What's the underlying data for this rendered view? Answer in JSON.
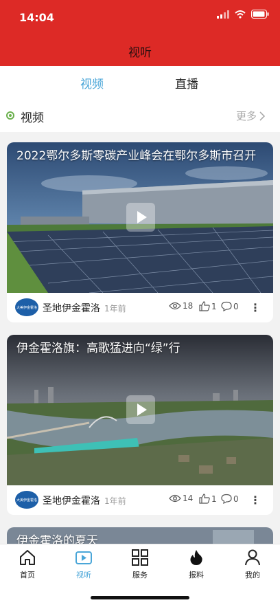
{
  "status_bar": {
    "time": "14:04"
  },
  "header": {
    "title": "视听"
  },
  "tabs": [
    {
      "label": "视频",
      "active": true
    },
    {
      "label": "直播",
      "active": false
    }
  ],
  "section": {
    "title": "视频",
    "more_label": "更多"
  },
  "videos": [
    {
      "title": "2022鄂尔多斯零碳产业峰会在鄂尔多斯市召开",
      "author": "圣地伊金霍洛",
      "time_ago": "1年前",
      "views": "18",
      "likes": "1",
      "comments": "0"
    },
    {
      "title": "伊金霍洛旗：高歌猛进向“绿”行",
      "author": "圣地伊金霍洛",
      "time_ago": "1年前",
      "views": "14",
      "likes": "1",
      "comments": "0"
    },
    {
      "title": "伊金霍洛的夏天"
    }
  ],
  "avatar_text": "大美伊金霍洛",
  "bottom_nav": [
    {
      "label": "首页",
      "icon": "home-icon",
      "active": false
    },
    {
      "label": "视听",
      "icon": "video-play-icon",
      "active": true
    },
    {
      "label": "服务",
      "icon": "grid-icon",
      "active": false
    },
    {
      "label": "报料",
      "icon": "flame-icon",
      "active": false
    },
    {
      "label": "我的",
      "icon": "user-icon",
      "active": false
    }
  ],
  "colors": {
    "brand_red": "#dd2a26",
    "accent_blue": "#4aa6d8"
  }
}
